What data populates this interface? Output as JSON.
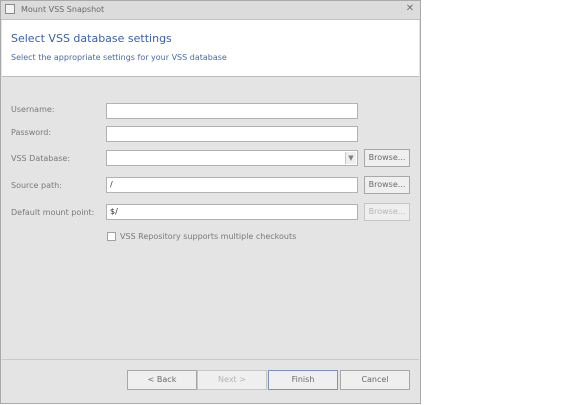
{
  "window": {
    "title": "Mount VSS Snapshot"
  },
  "header": {
    "title": "Select VSS database settings",
    "subtitle": "Select the appropriate settings for your VSS database"
  },
  "form": {
    "username_label": "Username:",
    "username_value": "",
    "password_label": "Password:",
    "password_value": "",
    "vss_database_label": "VSS Database:",
    "vss_database_value": "",
    "browse_label": "Browse...",
    "source_path_label": "Source path:",
    "source_path_value": "/",
    "mount_point_label": "Default mount point:",
    "mount_point_value": "$/",
    "checkbox_label": "VSS Repository supports multiple checkouts",
    "checkbox_checked": false
  },
  "footer": {
    "back_label": "< Back",
    "next_label": "Next >",
    "finish_label": "Finish",
    "cancel_label": "Cancel"
  }
}
